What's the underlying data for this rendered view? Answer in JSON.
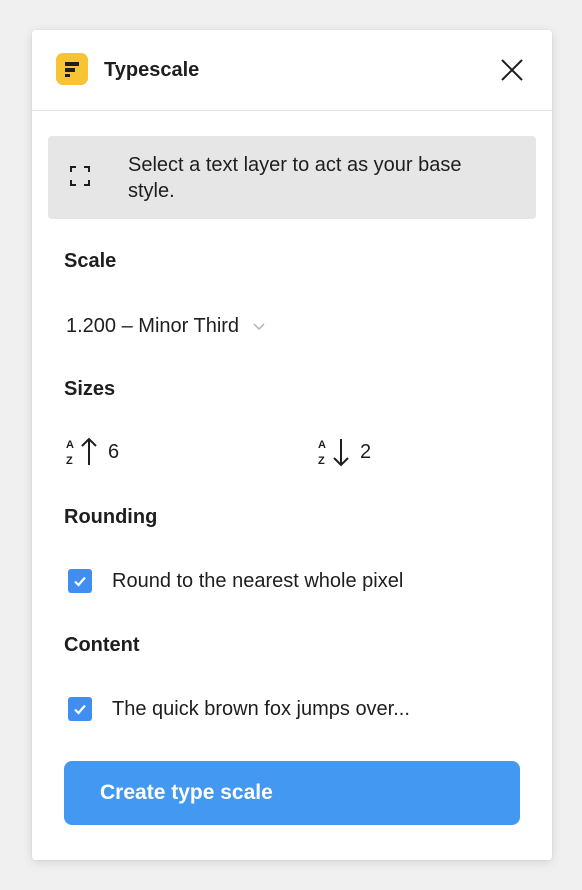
{
  "header": {
    "app_name": "Typescale",
    "app_icon": "typescale-logo-icon",
    "close_icon": "close-icon"
  },
  "notice": {
    "icon": "select-frame-icon",
    "text": "Select a text layer to act as your base style."
  },
  "scale": {
    "label": "Scale",
    "selected": "1.200 – Minor Third"
  },
  "sizes": {
    "label": "Sizes",
    "larger_icon": "sort-ascending-icon",
    "larger_value": "6",
    "smaller_icon": "sort-descending-icon",
    "smaller_value": "2"
  },
  "rounding": {
    "label": "Rounding",
    "checkbox_label": "Round to the nearest whole pixel",
    "checked": true
  },
  "content": {
    "label": "Content",
    "checkbox_label": "The quick brown fox jumps over...",
    "checked": true
  },
  "actions": {
    "create_label": "Create type scale"
  },
  "colors": {
    "accent": "#4399f1",
    "checkbox": "#3f8ef0",
    "app_icon": "#f7c433"
  }
}
